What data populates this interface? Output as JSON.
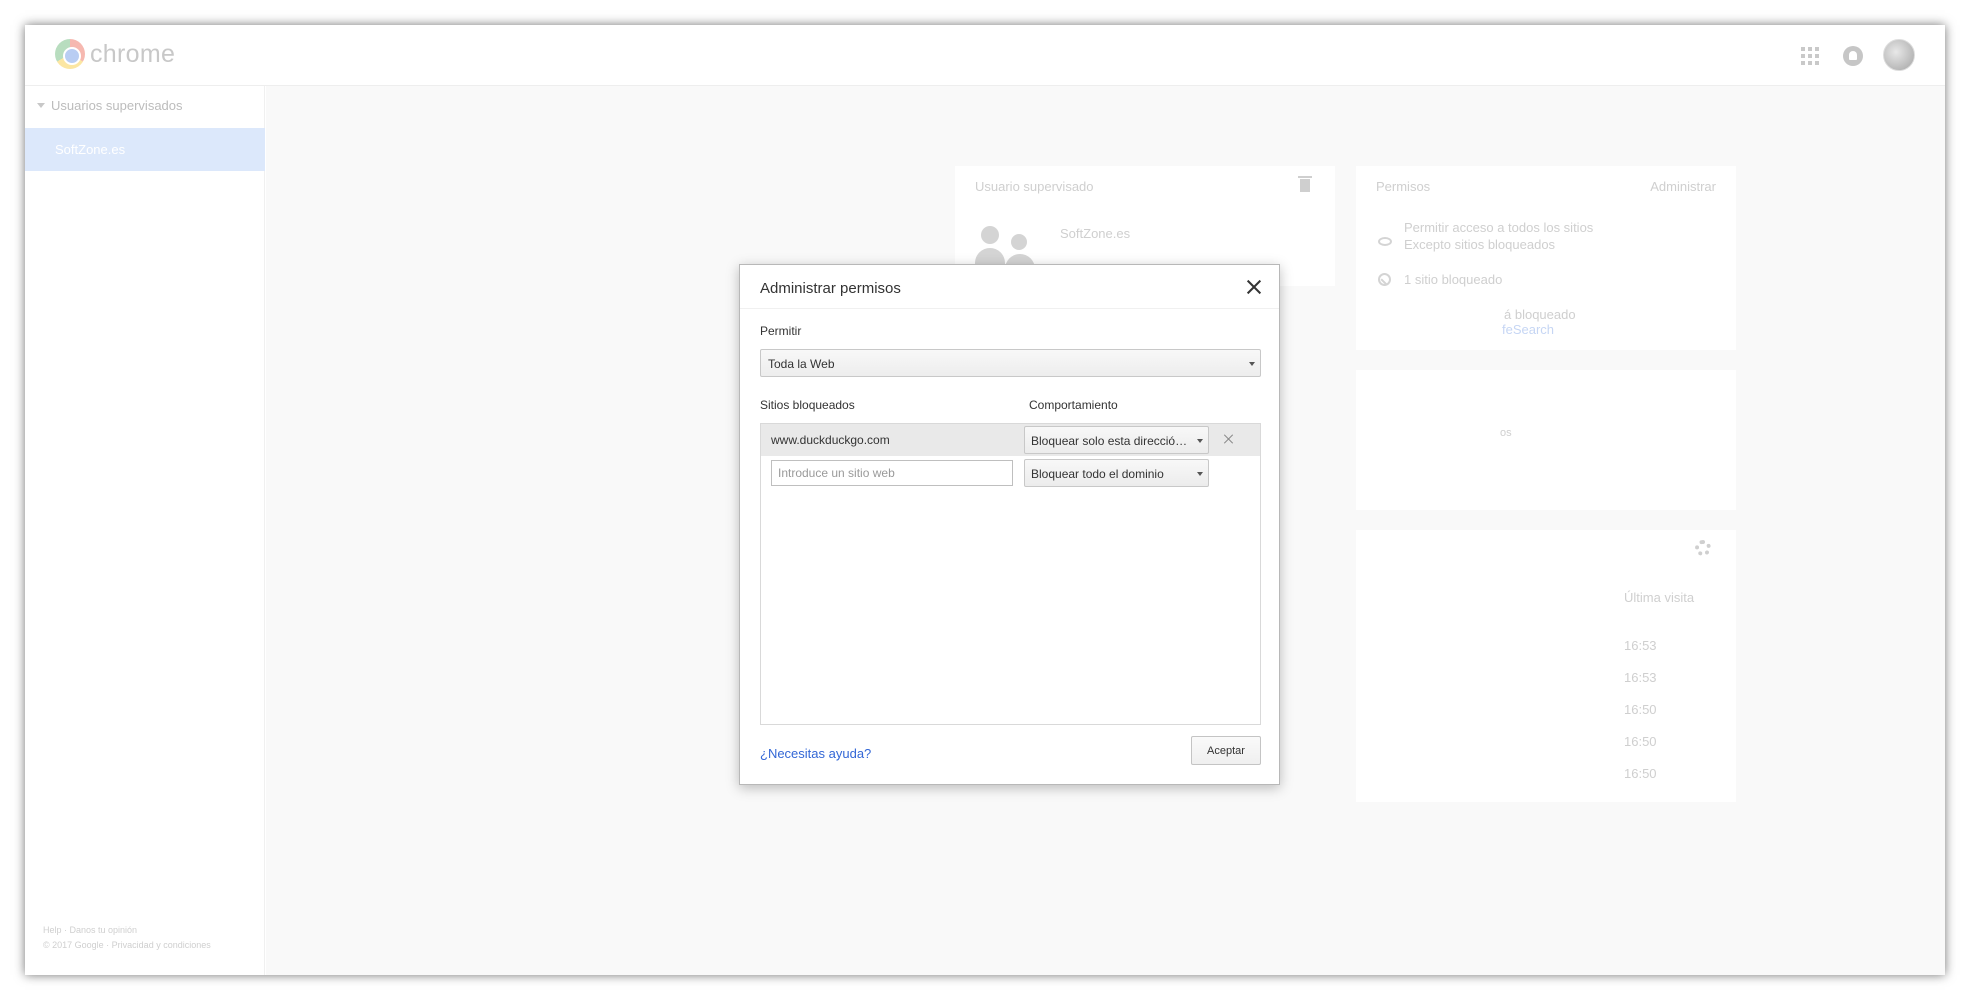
{
  "app": {
    "logo_text": "chrome"
  },
  "sidebar": {
    "header": "Usuarios supervisados",
    "items": [
      {
        "label": "SoftZone.es"
      }
    ],
    "footer_line1": "Help · Danos tu opinión",
    "footer_line2": "© 2017 Google · Privacidad y condiciones"
  },
  "background": {
    "user_card": {
      "title": "Usuario supervisado",
      "name": "SoftZone.es"
    },
    "permissions_card": {
      "title": "Permisos",
      "action": "Administrar",
      "allow_all": "Permitir acceso a todos los sitios",
      "allow_all_sub": "Excepto sitios bloqueados",
      "blocked_count": "1 sitio bloqueado",
      "safesearch_partial": "á bloqueado",
      "safesearch_link_partial": "feSearch"
    },
    "mid_card": {
      "partial_text": "os"
    },
    "history_card": {
      "column": "Última visita",
      "times": [
        "16:53",
        "16:53",
        "16:50",
        "16:50",
        "16:50"
      ]
    }
  },
  "modal": {
    "title": "Administrar permisos",
    "allow_label": "Permitir",
    "allow_value": "Toda la Web",
    "col_sites": "Sitios bloqueados",
    "col_behavior": "Comportamiento",
    "rows": [
      {
        "site": "www.duckduckgo.com",
        "behavior": "Bloquear solo esta dirección URL"
      }
    ],
    "new_site_placeholder": "Introduce un sitio web",
    "new_site_behavior": "Bloquear todo el dominio",
    "help_link": "¿Necesitas ayuda?",
    "accept": "Aceptar"
  }
}
